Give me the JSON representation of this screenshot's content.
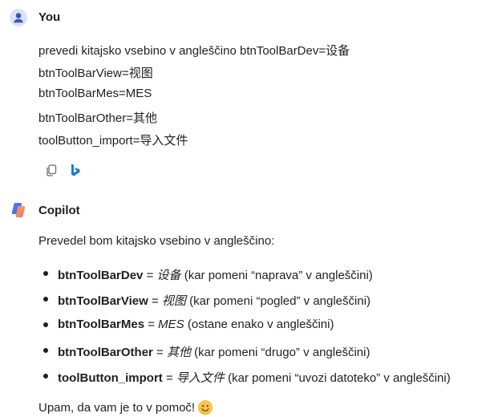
{
  "user": {
    "name": "You",
    "message_lines": [
      "prevedi kitajsko vsebino v angleščino btnToolBarDev=设备",
      "btnToolBarView=视图",
      "btnToolBarMes=MES",
      "btnToolBarOther=其他",
      "toolButton_import=导入文件"
    ],
    "actions": [
      "copy-icon",
      "bing-icon"
    ]
  },
  "copilot": {
    "name": "Copilot",
    "intro": "Prevedel bom kitajsko vsebino v angleščino:",
    "items": [
      {
        "key": "btnToolBarDev",
        "eq": " = ",
        "value": "设备",
        "note": " (kar pomeni “naprava” v angleščini)"
      },
      {
        "key": "btnToolBarView",
        "eq": " = ",
        "value": "视图",
        "note": " (kar pomeni “pogled” v angleščini)"
      },
      {
        "key": "btnToolBarMes",
        "eq": " = ",
        "value": "MES",
        "note": " (ostane enako v angleščini)"
      },
      {
        "key": "btnToolBarOther",
        "eq": " = ",
        "value": "其他",
        "note": " (kar pomeni “drugo” v angleščini)"
      },
      {
        "key": "toolButton_import",
        "eq": " = ",
        "value": "导入文件",
        "note": " (kar pomeni “uvozi datoteko” v angleščini)"
      }
    ],
    "outro": "Upam, da vam je to v pomoč!"
  },
  "colors": {
    "accent": "#3b55b8",
    "text": "#1f1f1f",
    "emoji": "#f7c548"
  }
}
